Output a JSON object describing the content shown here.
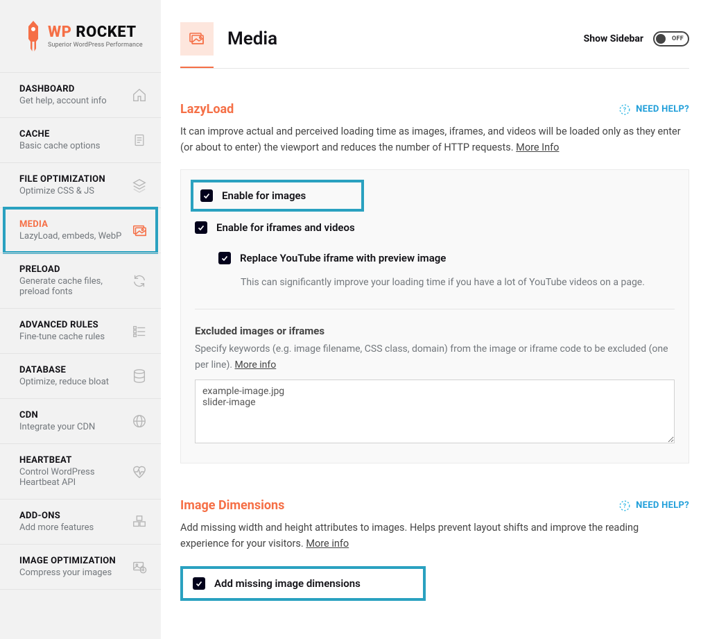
{
  "logo": {
    "brand_wp": "WP",
    "brand_rocket": " ROCKET",
    "tagline": "Superior WordPress Performance"
  },
  "sidebar": {
    "items": [
      {
        "title": "DASHBOARD",
        "desc": "Get help, account info",
        "icon": "home"
      },
      {
        "title": "CACHE",
        "desc": "Basic cache options",
        "icon": "doc"
      },
      {
        "title": "FILE OPTIMIZATION",
        "desc": "Optimize CSS & JS",
        "icon": "layers"
      },
      {
        "title": "MEDIA",
        "desc": "LazyLoad, embeds, WebP",
        "icon": "image"
      },
      {
        "title": "PRELOAD",
        "desc": "Generate cache files, preload fonts",
        "icon": "refresh"
      },
      {
        "title": "ADVANCED RULES",
        "desc": "Fine-tune cache rules",
        "icon": "sliders"
      },
      {
        "title": "DATABASE",
        "desc": "Optimize, reduce bloat",
        "icon": "database"
      },
      {
        "title": "CDN",
        "desc": "Integrate your CDN",
        "icon": "globe"
      },
      {
        "title": "HEARTBEAT",
        "desc": "Control WordPress Heartbeat API",
        "icon": "heartbeat"
      },
      {
        "title": "ADD-ONS",
        "desc": "Add more features",
        "icon": "boxes"
      },
      {
        "title": "IMAGE OPTIMIZATION",
        "desc": "Compress your images",
        "icon": "imageopt"
      }
    ]
  },
  "header": {
    "title": "Media",
    "show_sidebar_label": "Show Sidebar",
    "switch_text": "OFF"
  },
  "lazyload": {
    "title": "LazyLoad",
    "need_help": "NEED HELP?",
    "desc_a": "It can improve actual and perceived loading time as images, iframes, and videos will be loaded only as they enter (or about to enter) the viewport and reduces the number of HTTP requests. ",
    "more_info": "More Info",
    "opt_images": "Enable for images",
    "opt_iframes": "Enable for iframes and videos",
    "opt_youtube": "Replace YouTube iframe with preview image",
    "opt_youtube_desc": "This can significantly improve your loading time if you have a lot of YouTube videos on a page.",
    "excluded_title": "Excluded images or iframes",
    "excluded_desc": "Specify keywords (e.g. image filename, CSS class, domain) from the image or iframe code to be excluded (one per line). ",
    "excluded_more": "More info",
    "excluded_value": "example-image.jpg\nslider-image"
  },
  "dimensions": {
    "title": "Image Dimensions",
    "need_help": "NEED HELP?",
    "desc": "Add missing width and height attributes to images. Helps prevent layout shifts and improve the reading experience for your visitors. ",
    "more_info": "More info",
    "opt_label": "Add missing image dimensions"
  }
}
